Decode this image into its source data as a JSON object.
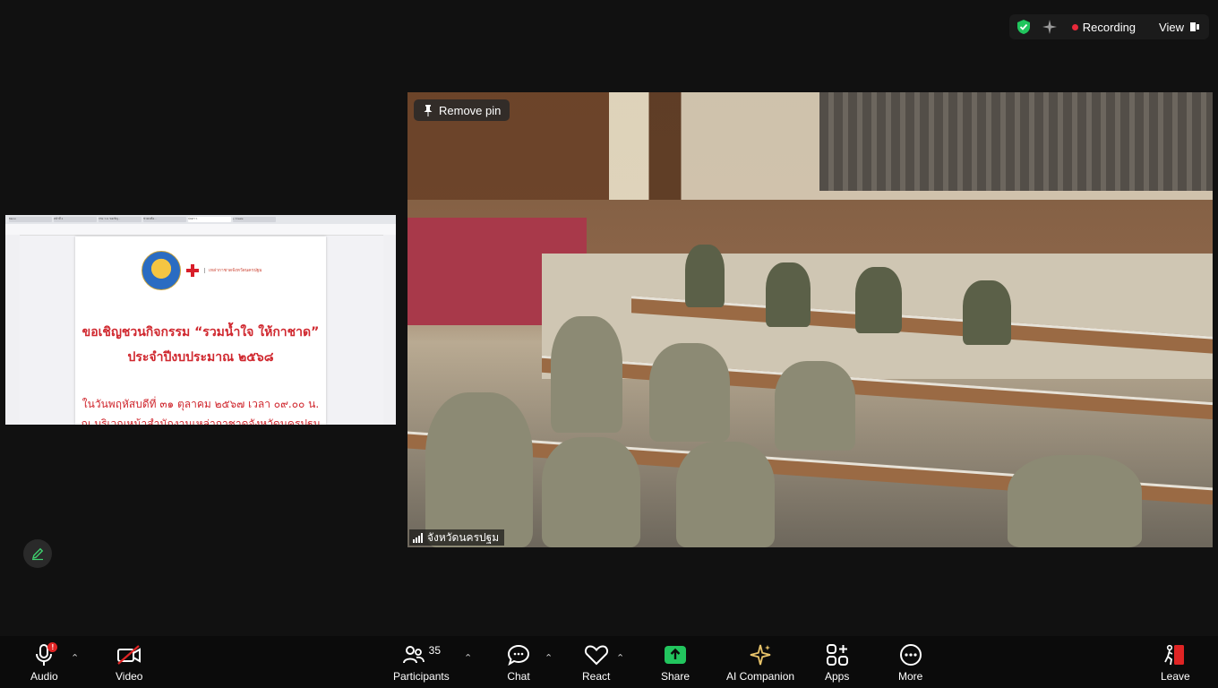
{
  "status_bar": {
    "recording_label": "Recording",
    "view_label": "View",
    "colors": {
      "shield": "#21c55d",
      "recording_dot": "#e8293a"
    }
  },
  "shared_screen": {
    "browser_tabs": [
      "Menu",
      "หน้าที่ 1",
      "กรม ว.ม. ขอเชิญ...",
      "ช่วยเหลือ...",
      "ปลดฯ ว.",
      "+ Create"
    ],
    "document": {
      "org_name": "เหล่ากาชาดจังหวัดนครปฐม",
      "title_line1": "ขอเชิญชวนกิจกรรม “รวมน้ำใจ ให้กาชาด”",
      "title_line2": "ประจำปีงบประมาณ ๒๕๖๘",
      "date_line": "ในวันพฤหัสบดีที่ ๓๑ ตุลาคม ๒๕๖๗ เวลา ๐๙.๐๐ น.",
      "place_line": "ณ บริเวณหน้าสำนักงานเหล่ากาชาดจังหวัดนครปฐม"
    }
  },
  "video": {
    "remove_pin_label": "Remove pin",
    "participant_name": "จังหวัดนครปฐม"
  },
  "toolbar": {
    "audio_label": "Audio",
    "video_label": "Video",
    "participants_label": "Participants",
    "participants_count": "35",
    "chat_label": "Chat",
    "react_label": "React",
    "share_label": "Share",
    "ai_companion_label": "AI Companion",
    "apps_label": "Apps",
    "more_label": "More",
    "leave_label": "Leave",
    "colors": {
      "share_green": "#22c55e",
      "ai_gold": "#e9c46a",
      "alert_red": "#e02424"
    }
  }
}
